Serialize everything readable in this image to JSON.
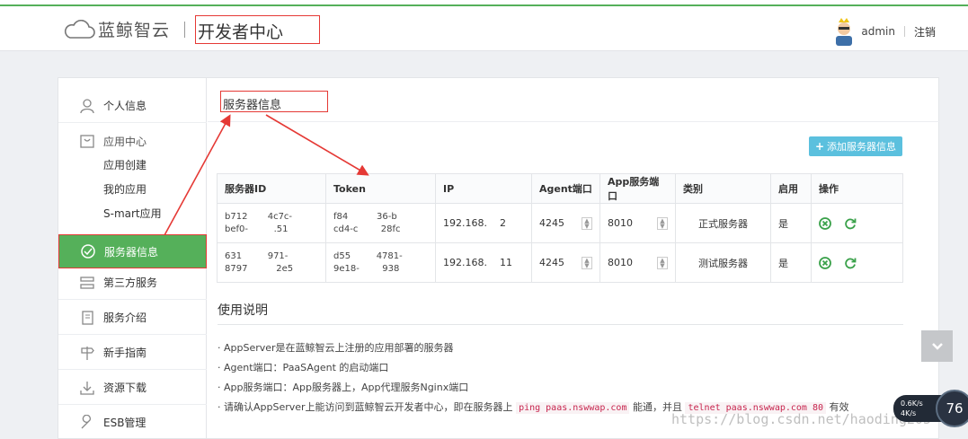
{
  "header": {
    "brand": "蓝鲸智云",
    "title": "开发者中心",
    "user": "admin",
    "logout": "注销"
  },
  "sidebar": {
    "personal": "个人信息",
    "app_center": "应用中心",
    "app_create": "应用创建",
    "my_apps": "我的应用",
    "smart_apps": "S-mart应用",
    "server_info": "服务器信息",
    "third_party": "第三方服务",
    "service_intro": "服务介绍",
    "guide": "新手指南",
    "downloads": "资源下载",
    "esb": "ESB管理"
  },
  "content": {
    "title": "服务器信息",
    "add_button": "添加服务器信息",
    "table": {
      "headers": [
        "服务器ID",
        "Token",
        "IP",
        "Agent端口",
        "App服务端口",
        "类别",
        "启用",
        "操作"
      ],
      "rows": [
        {
          "id_line1": "b712",
          "id_line2": "bef0-",
          "id_mid1": "4c7c-",
          "id_mid2": ".51",
          "token_line1": "f84",
          "token_line2": "cd4-c",
          "token_mid1": "36-b",
          "token_mid2": "28fc",
          "ip": "192.168.",
          "ip_tail": "2",
          "agent_port": "4245",
          "app_port": "8010",
          "category": "正式服务器",
          "enabled": "是"
        },
        {
          "id_line1": "631",
          "id_line2": "8797",
          "id_mid1": "971-",
          "id_mid2": "2e5",
          "token_line1": "d55",
          "token_line2": "9e18-",
          "token_mid1": "4781-",
          "token_mid2": "938",
          "ip": "192.168.",
          "ip_tail": "11",
          "agent_port": "4245",
          "app_port": "8010",
          "category": "测试服务器",
          "enabled": "是"
        }
      ]
    },
    "usage": {
      "title": "使用说明",
      "items": [
        "· AppServer是在蓝鲸智云上注册的应用部署的服务器",
        "· Agent端口：PaaSAgent 的启动端口",
        "· App服务端口：App服务器上，App代理服务Nginx端口"
      ],
      "last_prefix": "· 请确认AppServer上能访问到蓝鲸智云开发者中心，即在服务器上",
      "code1": "ping paas.nswwap.com",
      "last_mid": "能通，并且",
      "code2": "telnet paas.nswwap.com 80",
      "last_suffix": "有效"
    }
  },
  "overlay": {
    "watermark": "https://blog.csdn.net/haoding205",
    "net_speed": "0.6K/s",
    "net_sub": "4K/s",
    "gauge": "76"
  },
  "colors": {
    "accent_green": "#55b05a",
    "annotation_red": "#e53935",
    "button_blue": "#5bc0de"
  }
}
